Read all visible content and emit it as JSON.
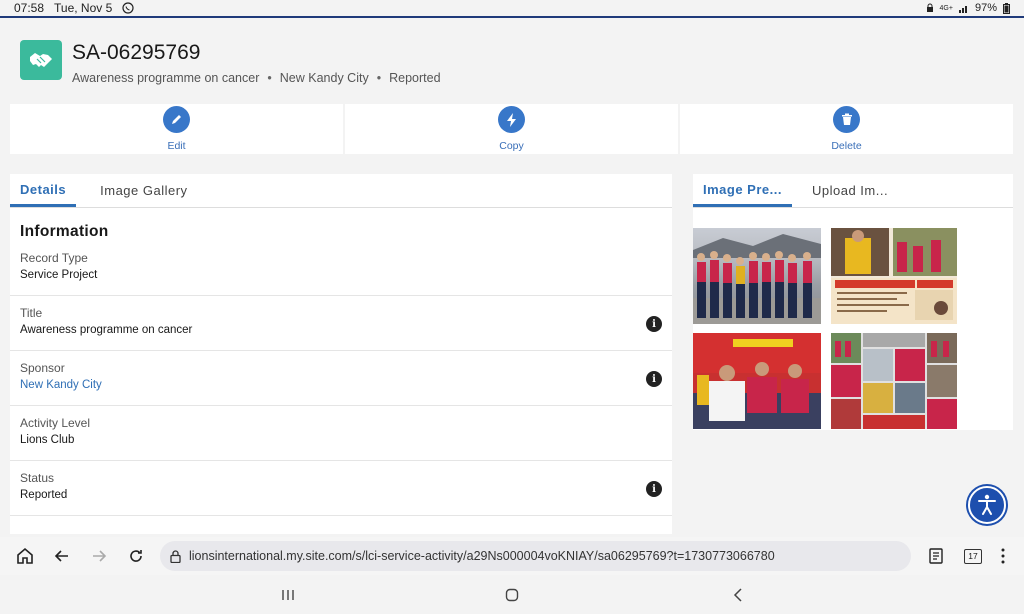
{
  "status_bar": {
    "time": "07:58",
    "date": "Tue, Nov 5",
    "battery": "97%",
    "network": "4G+"
  },
  "record": {
    "id": "SA-06295769",
    "title_meta": "Awareness programme on cancer",
    "sponsor_meta": "New Kandy City",
    "status_meta": "Reported",
    "icon": "handshake-icon"
  },
  "actions": [
    {
      "label": "Edit",
      "icon": "pencil-icon"
    },
    {
      "label": "Copy",
      "icon": "lightning-icon"
    },
    {
      "label": "Delete",
      "icon": "trash-icon"
    }
  ],
  "left_tabs": [
    {
      "label": "Details",
      "active": true
    },
    {
      "label": "Image Gallery",
      "active": false
    }
  ],
  "details": {
    "section_title": "Information",
    "fields": [
      {
        "label": "Record Type",
        "value": "Service Project",
        "info": false,
        "link": false
      },
      {
        "label": "Title",
        "value": "Awareness programme on cancer",
        "info": true,
        "link": false
      },
      {
        "label": "Sponsor",
        "value": "New Kandy City",
        "info": true,
        "link": true
      },
      {
        "label": "Activity Level",
        "value": "Lions Club",
        "info": false,
        "link": false
      },
      {
        "label": "Status",
        "value": "Reported",
        "info": true,
        "link": false
      }
    ]
  },
  "right_tabs": [
    {
      "label": "Image Pre...",
      "active": true
    },
    {
      "label": "Upload Im...",
      "active": false
    }
  ],
  "browser": {
    "url": "lionsinternational.my.site.com/s/lci-service-activity/a29Ns000004voKNIAY/sa06295769?t=1730773066780",
    "tab_count": "17"
  },
  "colors": {
    "accent": "#2f6fb5",
    "action_button": "#3877c9",
    "record_icon_bg": "#3bba9c",
    "accessibility_fab": "#1d4fae"
  }
}
